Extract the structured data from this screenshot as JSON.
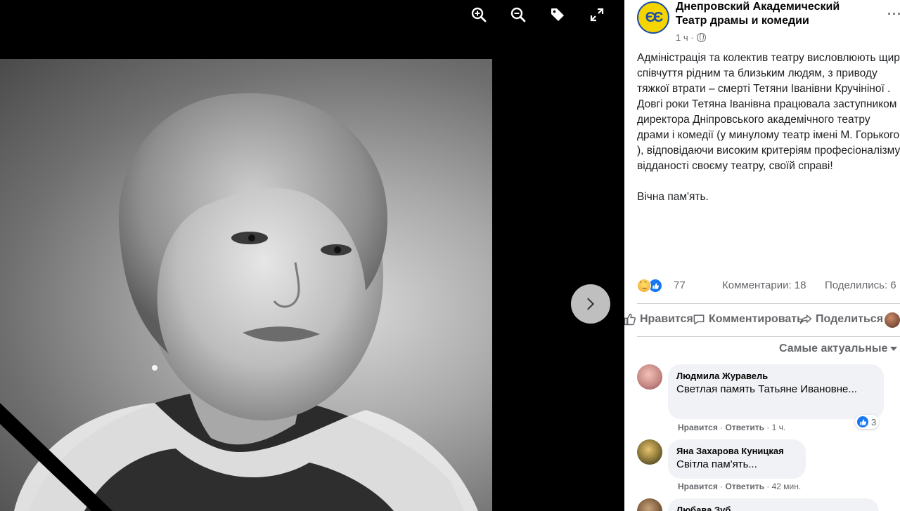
{
  "viewer": {
    "tools": [
      {
        "name": "zoom-in-icon"
      },
      {
        "name": "zoom-out-icon"
      },
      {
        "name": "tag-icon"
      },
      {
        "name": "fullscreen-icon"
      }
    ],
    "next_icon": "chevron-right-icon"
  },
  "post": {
    "page_name": "Днепровский Академический Театр драмы и комедии",
    "time": "1 ч ·",
    "more": "···",
    "text": "Адміністрація та колектив театру висловлюють щирі співчуття рідним та близьким людям, з приводу тяжкої втрати – смерті Тетяни Іванівни Кручініної .\nДовгі роки Тетяна Іванівна працювала заступником директора Дніпровського академічного театру драми і комедії (у минулому театр імені М. Горького ), відповідаючи високим критеріям професіоналізму, відданості своєму театру, своїй справі!\n\nВічна пам'ять.",
    "reactions_count": "77",
    "comments_count": "Комментарии: 18",
    "shares_count": "Поделились: 6",
    "actions": {
      "like": "Нравится",
      "comment": "Комментировать",
      "share": "Поделиться"
    },
    "sort_label": "Самые актуальные"
  },
  "comments": [
    {
      "author": "Людмила Журавель",
      "text": "Светлая память Татьяне Ивановне...",
      "like": "Нравится",
      "reply": "Ответить",
      "time": "1 ч.",
      "reactions": "3"
    },
    {
      "author": "Яна Захарова Куницкая",
      "text": "Світла пам'ять...",
      "like": "Нравится",
      "reply": "Ответить",
      "time": "42 мин."
    },
    {
      "author": "Любава Зуб"
    }
  ]
}
